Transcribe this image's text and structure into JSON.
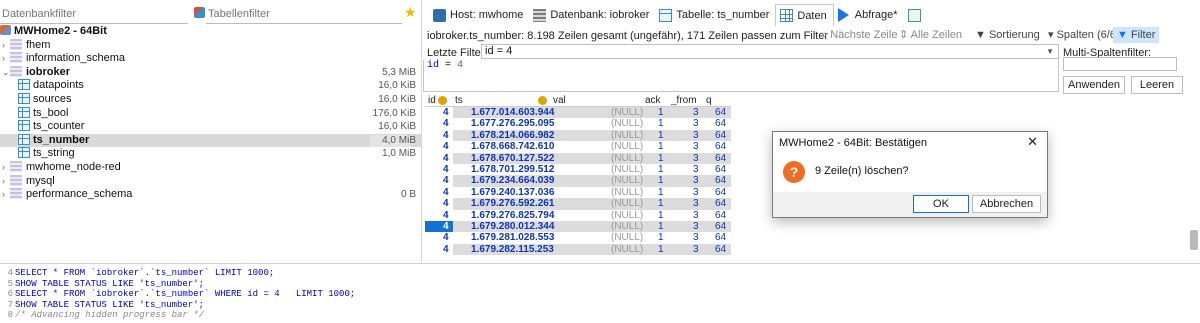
{
  "left_panel": {
    "db_filter_placeholder": "Datenbankfilter",
    "table_filter_placeholder": "Tabellenfilter",
    "host": "MWHome2 - 64Bit",
    "tree": [
      {
        "type": "db",
        "label": "fhem",
        "size": ""
      },
      {
        "type": "db",
        "label": "information_schema",
        "size": ""
      },
      {
        "type": "db",
        "label": "iobroker",
        "size": "5,3 MiB",
        "expanded": true
      },
      {
        "type": "table",
        "label": "datapoints",
        "size": "16,0 KiB"
      },
      {
        "type": "table",
        "label": "sources",
        "size": "16,0 KiB"
      },
      {
        "type": "table",
        "label": "ts_bool",
        "size": "176,0 KiB"
      },
      {
        "type": "table",
        "label": "ts_counter",
        "size": "16,0 KiB"
      },
      {
        "type": "table",
        "label": "ts_number",
        "size": "4,0 MiB",
        "selected": true
      },
      {
        "type": "table",
        "label": "ts_string",
        "size": "1,0 MiB"
      },
      {
        "type": "db",
        "label": "mwhome_node-red",
        "size": ""
      },
      {
        "type": "db",
        "label": "mysql",
        "size": ""
      },
      {
        "type": "db",
        "label": "performance_schema",
        "size": "0 B"
      }
    ]
  },
  "tabs": {
    "host": "Host: mwhome",
    "database": "Datenbank: iobroker",
    "table": "Tabelle: ts_number",
    "data": "Daten",
    "query": "Abfrage*"
  },
  "toolbar": {
    "info": "iobroker.ts_number: 8.198 Zeilen gesamt (ungefähr), 171 Zeilen passen zum Filter",
    "next_rows": "Nächste Zeile",
    "all_rows": "Alle Zeilen",
    "sort": "Sortierung",
    "columns": "Spalten (6/6)",
    "filter": "Filter"
  },
  "filter": {
    "label": "Letzte Filter",
    "value": "id = 4",
    "sql_ident": "id",
    "sql_op": " = ",
    "sql_val": "4",
    "multi_label": "Multi-Spaltenfilter:",
    "apply_button": "Anwenden",
    "clear_button": "Leeren"
  },
  "grid": {
    "columns": [
      "id",
      "ts",
      "val",
      "ack",
      "_from",
      "q"
    ],
    "rows": [
      {
        "id": "4",
        "ts": "1.677.014.603.944",
        "val": "(NULL)",
        "ack": "1",
        "from": "3",
        "q": "64"
      },
      {
        "id": "4",
        "ts": "1.677.276.295.095",
        "val": "(NULL)",
        "ack": "1",
        "from": "3",
        "q": "64"
      },
      {
        "id": "4",
        "ts": "1.678.214.066.982",
        "val": "(NULL)",
        "ack": "1",
        "from": "3",
        "q": "64"
      },
      {
        "id": "4",
        "ts": "1.678.668.742.610",
        "val": "(NULL)",
        "ack": "1",
        "from": "3",
        "q": "64"
      },
      {
        "id": "4",
        "ts": "1.678.670.127.522",
        "val": "(NULL)",
        "ack": "1",
        "from": "3",
        "q": "64"
      },
      {
        "id": "4",
        "ts": "1.678.701.299.512",
        "val": "(NULL)",
        "ack": "1",
        "from": "3",
        "q": "64"
      },
      {
        "id": "4",
        "ts": "1.679.234.664.039",
        "val": "(NULL)",
        "ack": "1",
        "from": "3",
        "q": "64"
      },
      {
        "id": "4",
        "ts": "1.679.240.137.036",
        "val": "(NULL)",
        "ack": "1",
        "from": "3",
        "q": "64"
      },
      {
        "id": "4",
        "ts": "1.679.276.592.261",
        "val": "(NULL)",
        "ack": "1",
        "from": "3",
        "q": "64"
      },
      {
        "id": "4",
        "ts": "1.679.276.825.794",
        "val": "(NULL)",
        "ack": "1",
        "from": "3",
        "q": "64"
      },
      {
        "id": "4",
        "ts": "1.679.280.012.344",
        "val": "(NULL)",
        "ack": "1",
        "from": "3",
        "q": "64",
        "current": true
      },
      {
        "id": "4",
        "ts": "1.679.281.028.553",
        "val": "(NULL)",
        "ack": "1",
        "from": "3",
        "q": "64"
      },
      {
        "id": "4",
        "ts": "1.679.282.115.253",
        "val": "(NULL)",
        "ack": "1",
        "from": "3",
        "q": "64"
      }
    ]
  },
  "dialog": {
    "title": "MWHome2 - 64Bit: Bestätigen",
    "message": "9 Zeile(n) löschen?",
    "ok_button": "OK",
    "cancel_button": "Abbrechen"
  },
  "query_log": [
    {
      "num": "4",
      "code": "SELECT * FROM `iobroker`.`ts_number` LIMIT 1000;"
    },
    {
      "num": "5",
      "code": "SHOW TABLE STATUS LIKE 'ts_number';"
    },
    {
      "num": "6",
      "code": "SELECT * FROM `iobroker`.`ts_number` WHERE id = 4   LIMIT 1000;"
    },
    {
      "num": "7",
      "code": "SHOW TABLE STATUS LIKE 'ts_number';"
    },
    {
      "num": "8",
      "code": "/* Advancing hidden progress bar */",
      "comment": true
    }
  ],
  "colors": {
    "accent": "#1572d2",
    "key": "#e0a400",
    "value_text": "#0b35b8",
    "dialog_icon": "#f26b21"
  }
}
